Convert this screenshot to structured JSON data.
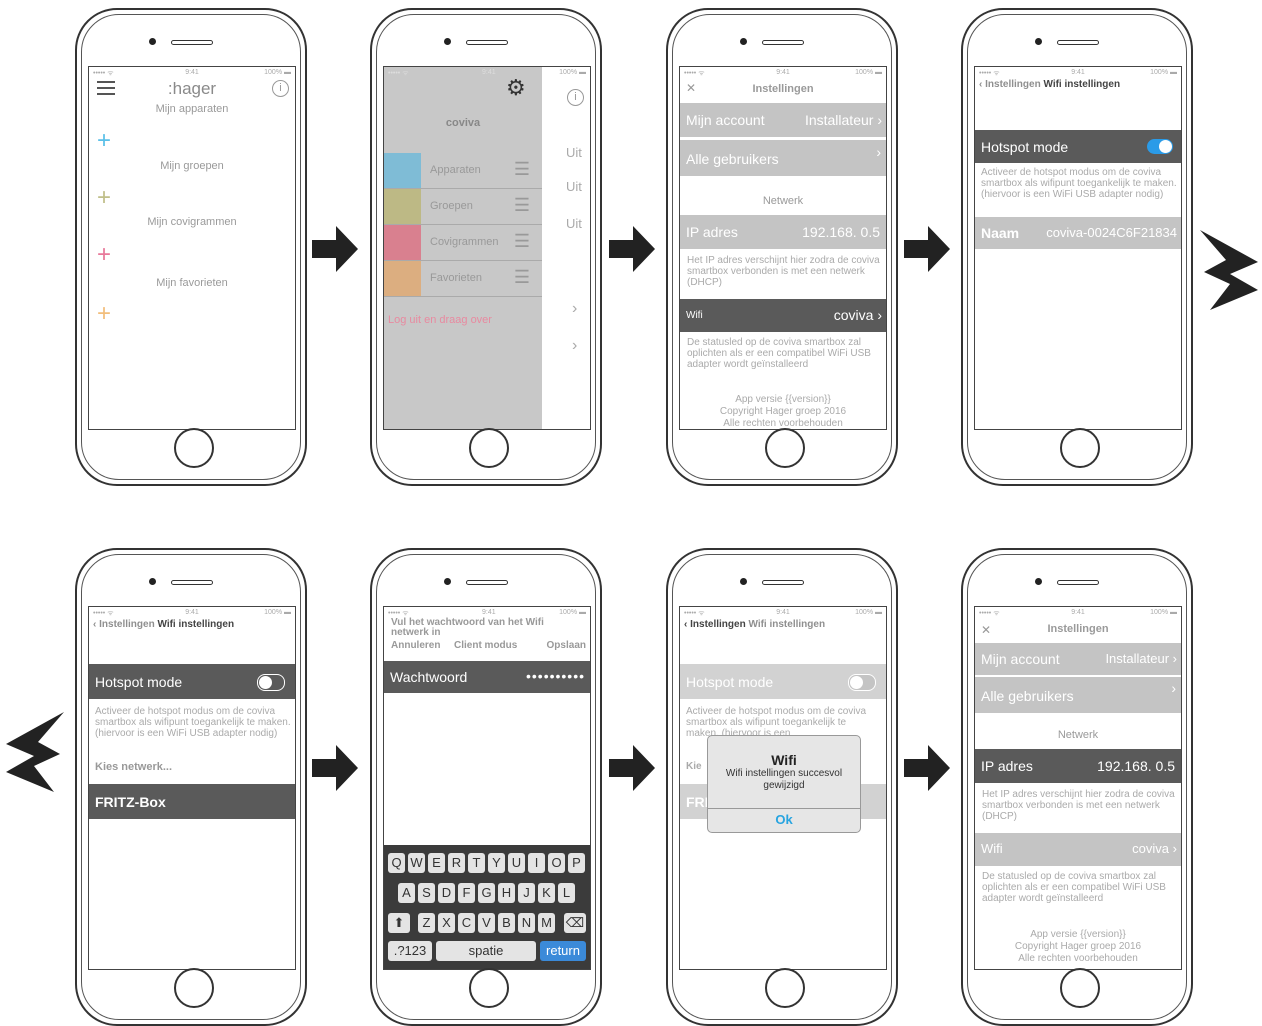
{
  "status": {
    "signal": "••••• ",
    "time": "9:41",
    "battery": "100%"
  },
  "colors": {
    "blue": "#5bc0e8",
    "olive": "#c0bf8a",
    "pink": "#e8799a",
    "orange": "#f2be7c",
    "toggle_on": "#2a9be8",
    "return_key": "#3b8ad9",
    "ok": "#27a4e0"
  },
  "screen1": {
    "logo": ":hager",
    "sections": [
      "Mijn apparaten",
      "Mijn groepen",
      "Mijn covigrammen",
      "Mijn favorieten"
    ],
    "plus": "+"
  },
  "screen2": {
    "title": "coviva",
    "items": [
      "Apparaten",
      "Groepen",
      "Covigrammen",
      "Favorieten"
    ],
    "logout": "Log uit en draag over",
    "right_labels": [
      "Uit",
      "Uit",
      "Uit"
    ]
  },
  "screen3": {
    "title": "Instellingen",
    "account_label": "Mijn account",
    "account_value": "Installateur",
    "users_label": "Alle gebruikers",
    "network_header": "Netwerk",
    "ip_label": "IP adres",
    "ip_value": "192.168. 0.5",
    "ip_note": "Het IP adres verschijnt hier zodra de coviva smartbox verbonden is met een netwerk (DHCP)",
    "wifi_label": "Wifi",
    "wifi_value": "coviva",
    "wifi_note": "De statusled op de coviva smartbox zal oplichten als er een compatibel WiFi USB adapter wordt geïnstalleerd",
    "version": "App versie {{version}}",
    "copyright": "Copyright Hager groep 2016",
    "rights": "Alle rechten voorbehouden"
  },
  "screen4": {
    "back": "Instellingen",
    "title": "Wifi instellingen",
    "hotspot_label": "Hotspot mode",
    "hotspot_note": "Activeer de hotspot modus om de coviva smartbox als wifipunt toegankelijk te maken. (hiervoor is een WiFi USB adapter nodig)",
    "name_label": "Naam",
    "name_value": "coviva-0024C6F21834"
  },
  "screen5": {
    "back": "Instellingen",
    "title": "Wifi instellingen",
    "hotspot_label": "Hotspot mode",
    "hotspot_note": "Activeer de hotspot modus om de coviva smartbox als wifipunt toegankelijk te maken. (hiervoor is een WiFi USB adapter nodig)",
    "choose": "Kies netwerk...",
    "network": "FRITZ-Box"
  },
  "screen6": {
    "prompt": "Vul het wachtwoord van het Wifi netwerk in",
    "cancel": "Annuleren",
    "mode": "Client modus",
    "save": "Opslaan",
    "pw_label": "Wachtwoord",
    "pw_value": "••••••••••",
    "row1": [
      "Q",
      "W",
      "E",
      "R",
      "T",
      "Y",
      "U",
      "I",
      "O",
      "P"
    ],
    "row2": [
      "A",
      "S",
      "D",
      "F",
      "G",
      "H",
      "J",
      "K",
      "L"
    ],
    "row3": [
      "Z",
      "X",
      "C",
      "V",
      "B",
      "N",
      "M"
    ],
    "numbers": ".?123",
    "space": "spatie",
    "return": "return",
    "shift": "⬆",
    "delete": "⌫"
  },
  "screen7": {
    "back": "Instellingen",
    "title": "Wifi instellingen",
    "hotspot_label": "Hotspot mode",
    "note_fragment": "Activeer de hotspot modus om de coviva smartbox als wifipunt toegankelijk te maken. (hiervoor is een",
    "kies_fragment": "Kie",
    "fr_fragment": "FRI",
    "alert_title": "Wifi",
    "alert_message": "Wifi instellingen succesvol gewijzigd",
    "alert_ok": "Ok"
  },
  "screen8": {
    "title": "Instellingen",
    "account_label": "Mijn account",
    "account_value": "Installateur",
    "users_label": "Alle gebruikers",
    "network_header": "Netwerk",
    "ip_label": "IP adres",
    "ip_value": "192.168. 0.5",
    "ip_note": "Het IP adres verschijnt hier zodra de coviva smartbox verbonden is met een netwerk (DHCP)",
    "wifi_label": "Wifi",
    "wifi_value": "coviva",
    "wifi_note": "De statusled op de coviva smartbox zal oplichten als er een compatibel WiFi USB adapter wordt geïnstalleerd",
    "version": "App versie {{version}}",
    "copyright": "Copyright Hager groep 2016",
    "rights": "Alle rechten voorbehouden"
  },
  "glyphs": {
    "chevron": "›",
    "back_chevron": "‹",
    "close": "✕"
  }
}
